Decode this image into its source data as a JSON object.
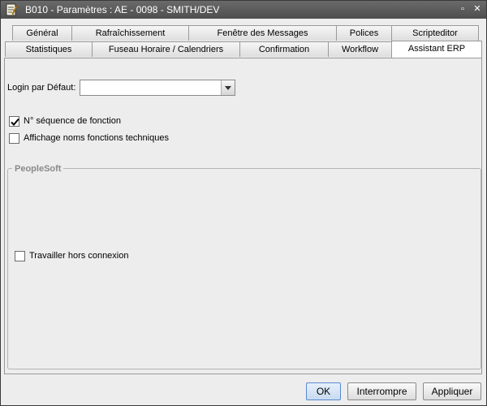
{
  "window": {
    "title": "B010 - Paramètres : AE - 0098 - SMITH/DEV",
    "maximize_glyph": "▫",
    "close_glyph": "✕"
  },
  "tabs_row1": [
    {
      "label": "Général"
    },
    {
      "label": "Rafraîchissement"
    },
    {
      "label": "Fenêtre des Messages"
    },
    {
      "label": "Polices"
    },
    {
      "label": "Scripteditor"
    }
  ],
  "tabs_row2": [
    {
      "label": "Statistiques"
    },
    {
      "label": "Fuseau Horaire / Calendriers"
    },
    {
      "label": "Confirmation"
    },
    {
      "label": "Workflow"
    },
    {
      "label": "Assistant ERP",
      "active": true
    }
  ],
  "panel": {
    "login_label": "Login par Défaut:",
    "login_value": "",
    "seq_label": "N° séquence de fonction",
    "seq_checked": true,
    "tech_label": "Affichage noms fonctions techniques",
    "tech_checked": false,
    "group_title": "PeopleSoft",
    "offline_label": "Travailler hors connexion",
    "offline_checked": false
  },
  "buttons": {
    "ok": "OK",
    "abort": "Interrompre",
    "apply": "Appliquer"
  }
}
